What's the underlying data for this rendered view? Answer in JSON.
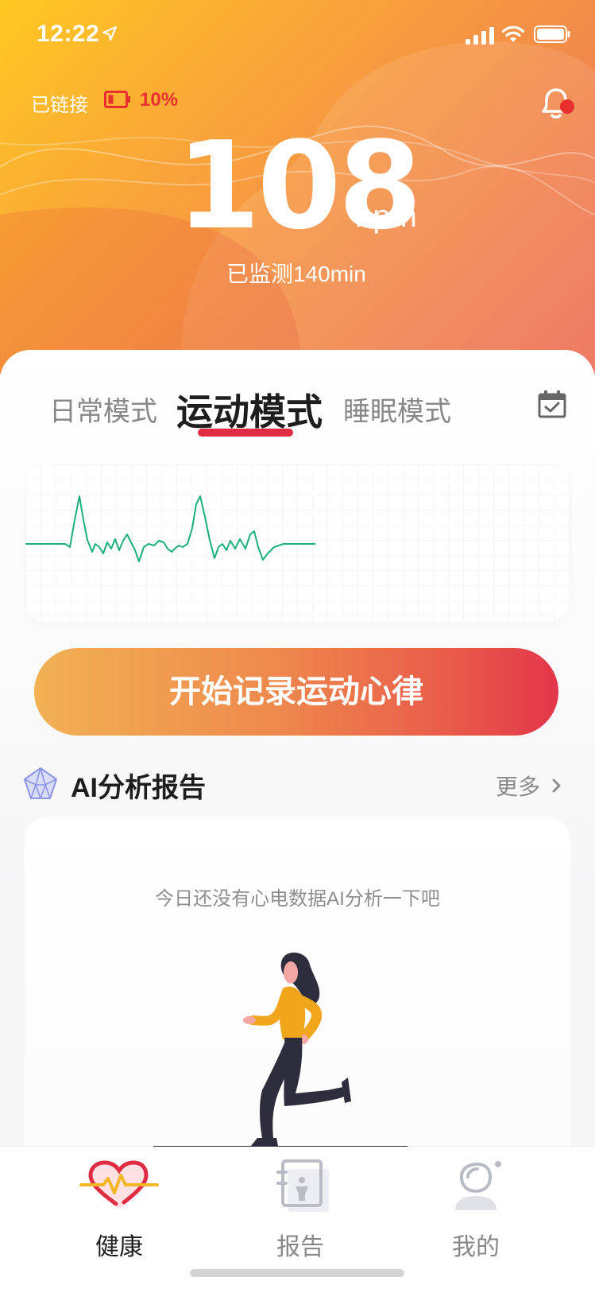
{
  "status_bar": {
    "time": "12:22"
  },
  "device": {
    "connection_label": "已链接",
    "battery_percent": "10%"
  },
  "heart_rate": {
    "value": "108",
    "unit": "bpm",
    "monitored_text": "已监测140min"
  },
  "modes": {
    "tabs": [
      {
        "label": "日常模式"
      },
      {
        "label": "运动模式"
      },
      {
        "label": "睡眠模式"
      }
    ],
    "active_index": 1
  },
  "start_button_label": "开始记录运动心律",
  "ai_report": {
    "title": "AI分析报告",
    "more_label": "更多",
    "empty_text": "今日还没有心电数据AI分析一下吧"
  },
  "tabbar": {
    "items": [
      {
        "label": "健康",
        "icon": "heart-pulse-icon",
        "active": true
      },
      {
        "label": "报告",
        "icon": "report-icon",
        "active": false
      },
      {
        "label": "我的",
        "icon": "user-icon",
        "active": false
      }
    ]
  },
  "colors": {
    "accent": "#e02c43",
    "ecg_line": "#1bb07a",
    "battery_warning": "#e8302f"
  }
}
